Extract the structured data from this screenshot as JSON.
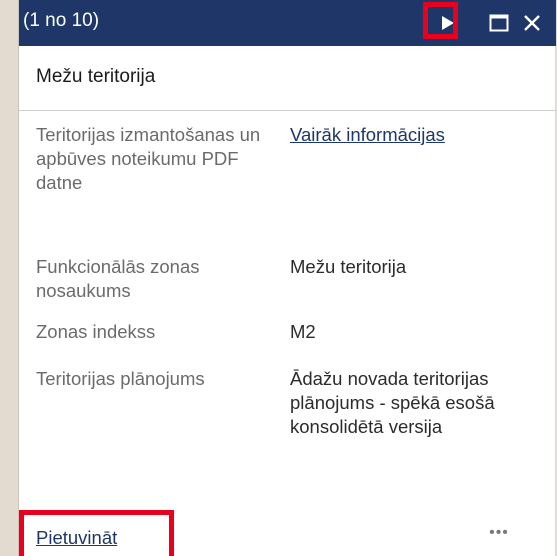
{
  "popup": {
    "counter": "(1 no 10)",
    "feature_title": "Mežu teritorija",
    "fields": [
      {
        "label": "Teritorijas izmantošanas un apbūves noteikumu PDF datne",
        "value": "Vairāk informācijas",
        "value_is_link": true
      },
      {
        "label": "Funkcionālās zonas nosaukums",
        "value": "Mežu teritorija"
      },
      {
        "label": "Zonas indekss",
        "value": "M2"
      },
      {
        "label": "Teritorijas plānojums",
        "value": "Ādažu novada teritorijas plānojums - spēkā esošā konsolidētā versija"
      }
    ],
    "footer": {
      "zoom_label": "Pietuvināt",
      "more_label": "•••"
    },
    "icons": {
      "next": "play-triangle-icon",
      "maximize": "square-icon",
      "close": "x-icon"
    },
    "colors": {
      "header": "#1e3768",
      "highlight": "#e8001c",
      "link": "#1e3768"
    }
  }
}
